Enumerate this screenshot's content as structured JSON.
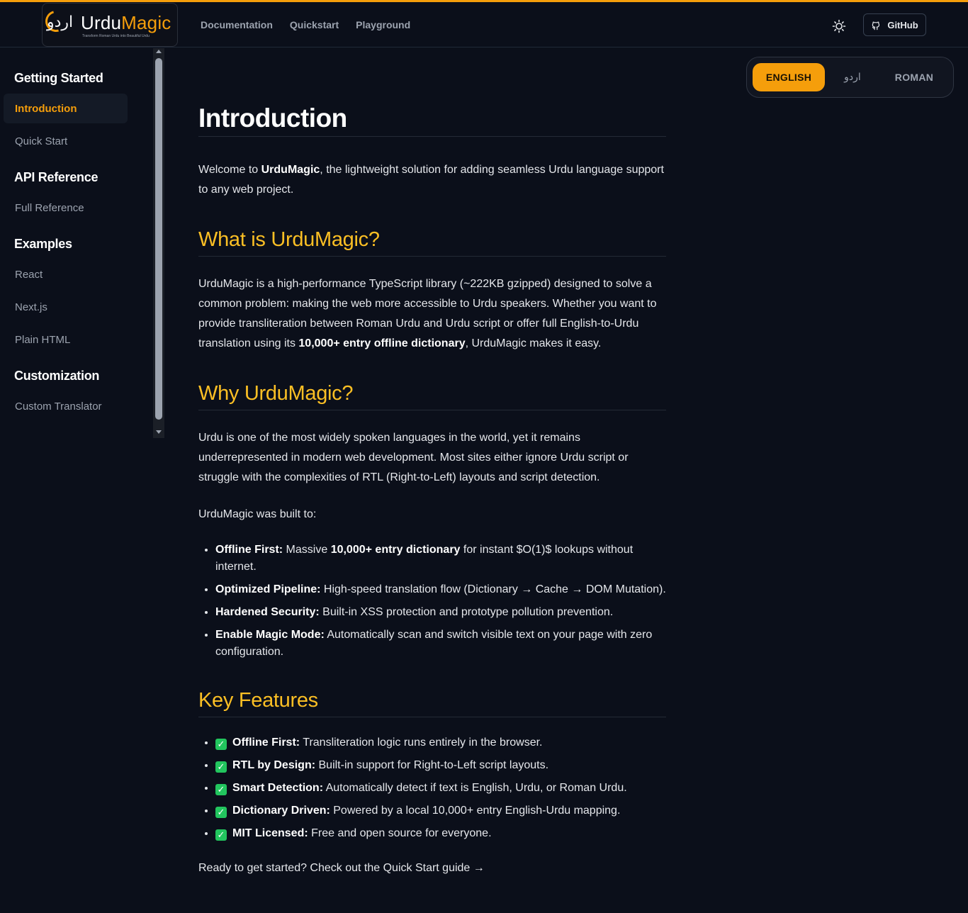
{
  "brand": {
    "urdu_mark": "اردو",
    "name_part1": "Urdu",
    "name_part2": "Magic",
    "tagline": "Transform Roman Urdu into Beautiful Urdu"
  },
  "nav": [
    "Documentation",
    "Quickstart",
    "Playground"
  ],
  "github_label": "GitHub",
  "colors": {
    "accent": "#f59e0b",
    "background": "#0b0f1a",
    "heading": "#fbbf24"
  },
  "sidebar": {
    "sections": [
      {
        "title": "Getting Started",
        "items": [
          "Introduction",
          "Quick Start"
        ]
      },
      {
        "title": "API Reference",
        "items": [
          "Full Reference"
        ]
      },
      {
        "title": "Examples",
        "items": [
          "React",
          "Next.js",
          "Plain HTML"
        ]
      },
      {
        "title": "Customization",
        "items": [
          "Custom Translator"
        ]
      }
    ],
    "active_item": "Introduction"
  },
  "language_switch": {
    "options": [
      "ENGLISH",
      "اردو",
      "ROMAN"
    ],
    "selected": "ENGLISH"
  },
  "content": {
    "title": "Introduction",
    "intro": {
      "p1": "Welcome to ",
      "b1": "UrduMagic",
      "p2": ", the lightweight solution for adding seamless Urdu language support to any web project."
    },
    "what_heading": "What is UrduMagic?",
    "what_para": {
      "p1": "UrduMagic is a high-performance TypeScript library (~222KB gzipped) designed to solve a common problem: making the web more accessible to Urdu speakers. Whether you want to provide transliteration between Roman Urdu and Urdu script or offer full English-to-Urdu translation using its ",
      "b1": "10,000+ entry offline dictionary",
      "p2": ", UrduMagic makes it easy."
    },
    "why_heading": "Why UrduMagic?",
    "why_para": "Urdu is one of the most widely spoken languages in the world, yet it remains underrepresented in modern web development. Most sites either ignore Urdu script or struggle with the complexities of RTL (Right-to-Left) layouts and script detection.",
    "built_to": "UrduMagic was built to:",
    "reasons": [
      {
        "label": "Offline First:",
        "pre": " Massive ",
        "bold": "10,000+ entry dictionary",
        "text": " for instant $O(1)$ lookups without internet."
      },
      {
        "label": "Optimized Pipeline:",
        "pre": "",
        "bold": "",
        "text": " High-speed translation flow (Dictionary → Cache → DOM Mutation)."
      },
      {
        "label": "Hardened Security:",
        "pre": "",
        "bold": "",
        "text": " Built-in XSS protection and prototype pollution prevention."
      },
      {
        "label": "Enable Magic Mode:",
        "pre": "",
        "bold": "",
        "text": " Automatically scan and switch visible text on your page with zero configuration."
      }
    ],
    "features_heading": "Key Features",
    "features": [
      {
        "label": "Offline First:",
        "text": " Transliteration logic runs entirely in the browser."
      },
      {
        "label": "RTL by Design:",
        "text": " Built-in support for Right-to-Left script layouts."
      },
      {
        "label": "Smart Detection:",
        "text": " Automatically detect if text is English, Urdu, or Roman Urdu."
      },
      {
        "label": "Dictionary Driven:",
        "text": " Powered by a local 10,000+ entry English-Urdu mapping."
      },
      {
        "label": "MIT Licensed:",
        "text": " Free and open source for everyone."
      }
    ],
    "footer_cta": "Ready to get started? Check out the Quick Start guide →"
  },
  "icons": {
    "theme": "sun-icon",
    "github": "github-icon",
    "feature": "check-icon"
  }
}
